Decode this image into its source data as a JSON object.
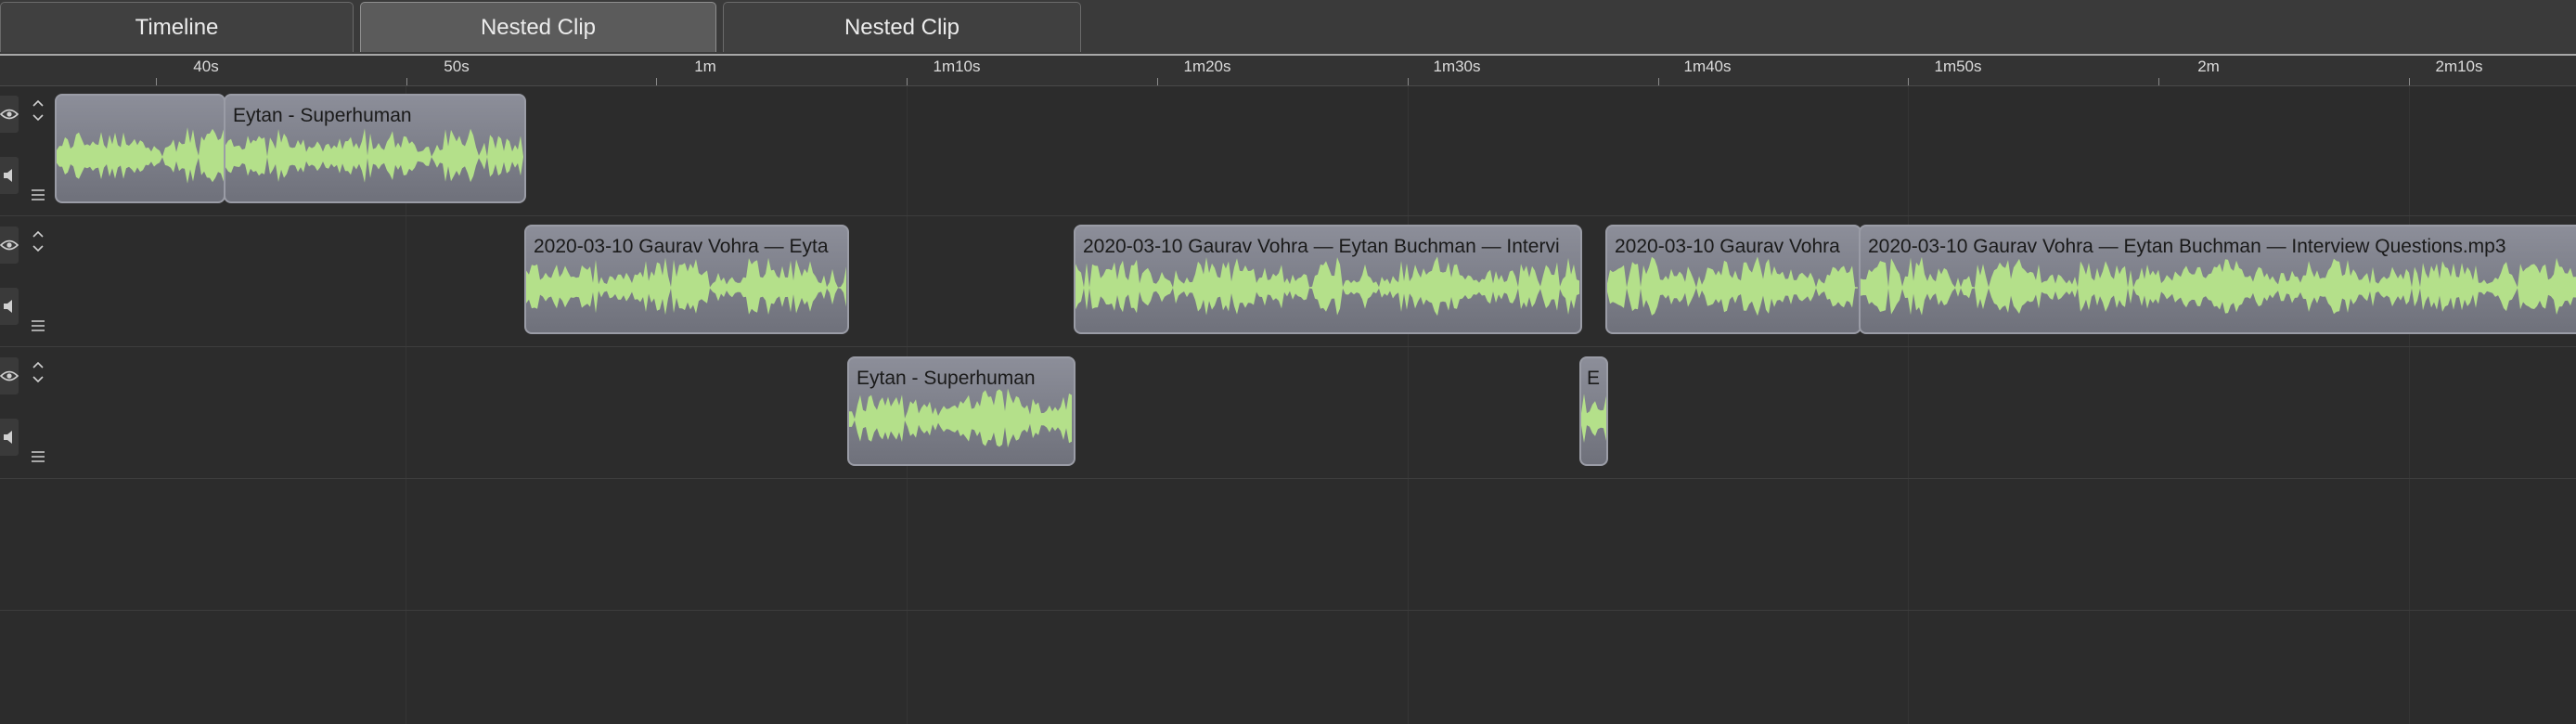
{
  "tabs": [
    {
      "label": "Timeline"
    },
    {
      "label": "Nested Clip"
    },
    {
      "label": "Nested Clip"
    }
  ],
  "ruler": {
    "labels": [
      "40s",
      "50s",
      "1m",
      "1m10s",
      "1m20s",
      "1m30s",
      "1m40s",
      "1m50s",
      "2m",
      "2m10s"
    ]
  },
  "tracks": [
    {
      "visibility_icon": "eye-icon",
      "audio_icon": "speaker-icon",
      "menu_icon": "menu-icon",
      "expand_icon": "expand-collapse-icon"
    },
    {
      "visibility_icon": "eye-icon",
      "audio_icon": "speaker-icon",
      "menu_icon": "menu-icon",
      "expand_icon": "expand-collapse-icon"
    },
    {
      "visibility_icon": "eye-icon",
      "audio_icon": "speaker-icon",
      "menu_icon": "menu-icon",
      "expand_icon": "expand-collapse-icon"
    }
  ],
  "clips": [
    {
      "track": 1,
      "title": ""
    },
    {
      "track": 1,
      "title": "Eytan - Superhuman"
    },
    {
      "track": 2,
      "title": "2020-03-10 Gaurav Vohra — Eyta"
    },
    {
      "track": 2,
      "title": "2020-03-10 Gaurav Vohra — Eytan Buchman — Intervi"
    },
    {
      "track": 2,
      "title": "2020-03-10 Gaurav Vohra"
    },
    {
      "track": 2,
      "title": "2020-03-10 Gaurav Vohra — Eytan Buchman — Interview Questions.mp3"
    },
    {
      "track": 3,
      "title": "Eytan - Superhuman"
    },
    {
      "track": 3,
      "title": "E"
    }
  ],
  "colors": {
    "waveform": "#b4e08a",
    "clip": "#8a8c97",
    "background": "#2c2c2c"
  }
}
